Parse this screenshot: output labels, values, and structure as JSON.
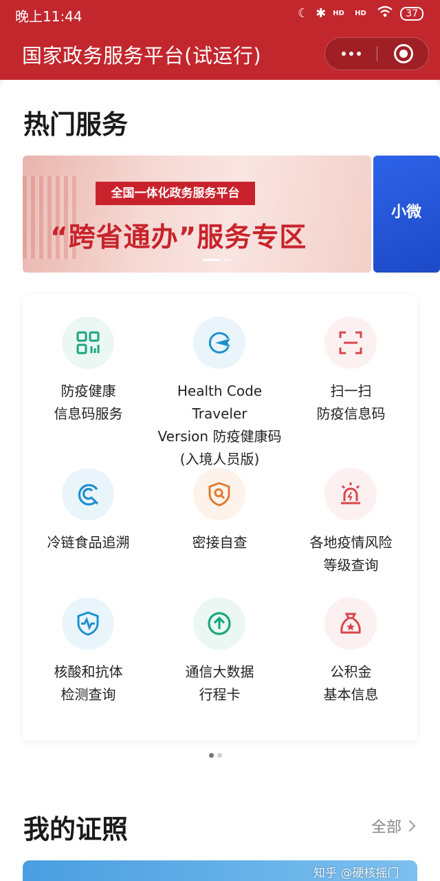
{
  "status_bar": {
    "time": "晚上11:44",
    "signal1": "HD",
    "signal2": "HD",
    "battery": "37"
  },
  "header": {
    "title": "国家政务服务平台(试运行)"
  },
  "hot_services": {
    "title": "热门服务",
    "banner": {
      "badge": "全国一体化政务服务平台",
      "headline": "“跨省通办”服务专区"
    },
    "banner_next": {
      "text": "小微"
    },
    "items": [
      {
        "label": "防疫健康\n信息码服务",
        "icon": "qr-grid-icon"
      },
      {
        "label": "Health Code Traveler\nVersion 防疫健康码\n(入境人员版)",
        "icon": "airplane-icon"
      },
      {
        "label": "扫一扫\n防疫信息码",
        "icon": "scan-icon"
      },
      {
        "label": "冷链食品追溯",
        "icon": "trace-icon"
      },
      {
        "label": "密接自查",
        "icon": "shield-search-icon"
      },
      {
        "label": "各地疫情风险\n等级查询",
        "icon": "alarm-light-icon"
      },
      {
        "label": "核酸和抗体\n检测查询",
        "icon": "shield-pulse-icon"
      },
      {
        "label": "通信大数据\n行程卡",
        "icon": "arrow-up-circle-icon"
      },
      {
        "label": "公积金\n基本信息",
        "icon": "money-bag-icon"
      }
    ]
  },
  "certificates": {
    "title": "我的证照",
    "view_all": "全部"
  },
  "watermark": {
    "text": "知乎 @硬核摇门"
  },
  "colors": {
    "header": "#c2272d",
    "green": "#1aa77a",
    "blue": "#1d8fcf",
    "red": "#d8454d",
    "orange": "#e07b2f"
  }
}
